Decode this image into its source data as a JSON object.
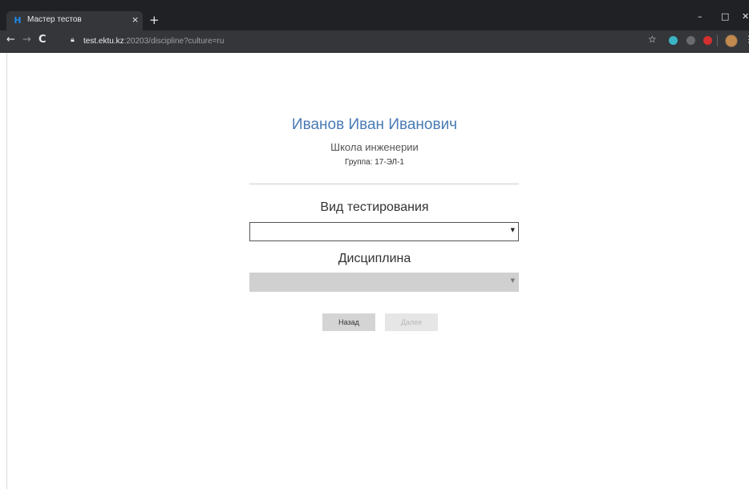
{
  "browser": {
    "tab_title": "Мастер тестов",
    "tab_favicon": "Н",
    "tab_close": "×",
    "new_tab": "+",
    "url_host": "test.ektu.kz",
    "url_path": ":20203/discipline?culture=ru",
    "window_controls": [
      "–",
      "□",
      "✕"
    ],
    "nav": {
      "back": "←",
      "forward": "→",
      "reload": "C"
    },
    "extension_colors": [
      "#3bb3c3",
      "#a0a0a0",
      "#d32f2f"
    ]
  },
  "page": {
    "user_name": "Иванов Иван Иванович",
    "school": "Школа инженерии",
    "group": "Группа: 17-ЭЛ-1",
    "testing_type_label": "Вид тестирования",
    "testing_type_value": "",
    "discipline_label": "Дисциплина",
    "discipline_value": "",
    "back_button": "Назад",
    "next_button": "Далее"
  }
}
